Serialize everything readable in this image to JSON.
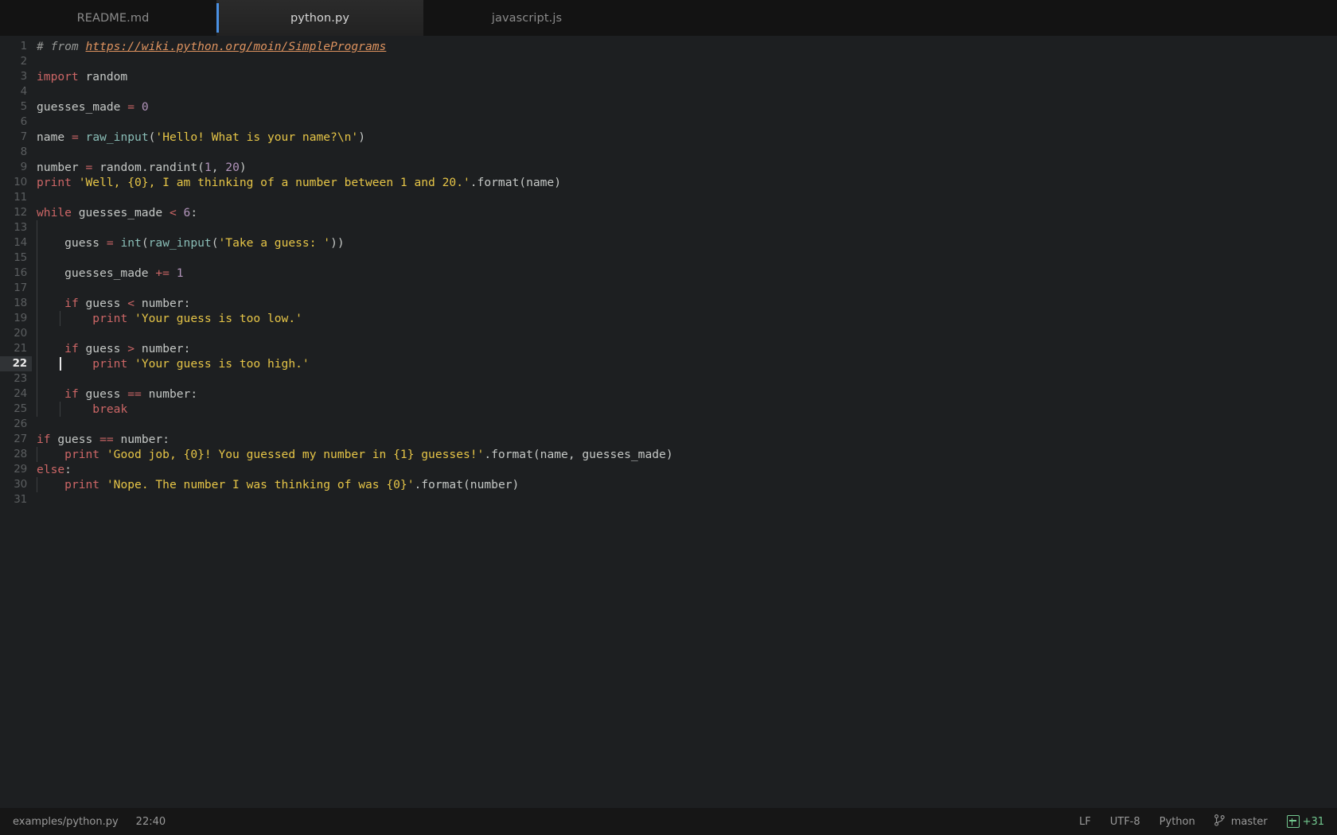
{
  "window": {
    "background_color": "#1d1f21",
    "tabbar_color": "#131313",
    "accent_color": "#4a90e2"
  },
  "tabs": [
    {
      "label": "README.md",
      "active": false
    },
    {
      "label": "python.py",
      "active": true
    },
    {
      "label": "javascript.js",
      "active": false
    }
  ],
  "editor": {
    "active_line": 22,
    "total_lines": 31,
    "line_numbers": [
      "1",
      "2",
      "3",
      "4",
      "5",
      "6",
      "7",
      "8",
      "9",
      "10",
      "11",
      "12",
      "13",
      "14",
      "15",
      "16",
      "17",
      "18",
      "19",
      "20",
      "21",
      "22",
      "23",
      "24",
      "25",
      "26",
      "27",
      "28",
      "29",
      "30",
      "31"
    ],
    "source_lines": [
      "# from https://wiki.python.org/moin/SimplePrograms",
      "",
      "import random",
      "",
      "guesses_made = 0",
      "",
      "name = raw_input('Hello! What is your name?\\n')",
      "",
      "number = random.randint(1, 20)",
      "print 'Well, {0}, I am thinking of a number between 1 and 20.'.format(name)",
      "",
      "while guesses_made < 6:",
      "",
      "    guess = int(raw_input('Take a guess: '))",
      "",
      "    guesses_made += 1",
      "",
      "    if guess < number:",
      "        print 'Your guess is too low.'",
      "",
      "    if guess > number:",
      "        print 'Your guess is too high.'",
      "",
      "    if guess == number:",
      "        break",
      "",
      "if guess == number:",
      "    print 'Good job, {0}! You guessed my number in {1} guesses!'.format(name, guesses_made)",
      "else:",
      "    print 'Nope. The number I was thinking of was {0}'.format(number)",
      ""
    ],
    "comment_url": "https://wiki.python.org/moin/SimplePrograms",
    "syntax_colors": {
      "comment": "#969896",
      "link": "#de935f",
      "keyword": "#cc6666",
      "function": "#8abeb7",
      "string": "#e6c547",
      "number": "#b294bb",
      "text": "#c5c8c6"
    }
  },
  "statusbar": {
    "file_path": "examples/python.py",
    "cursor_position": "22:40",
    "line_ending": "LF",
    "encoding": "UTF-8",
    "language": "Python",
    "branch": "master",
    "diff_count": "+31",
    "diff_color": "#73c990"
  }
}
